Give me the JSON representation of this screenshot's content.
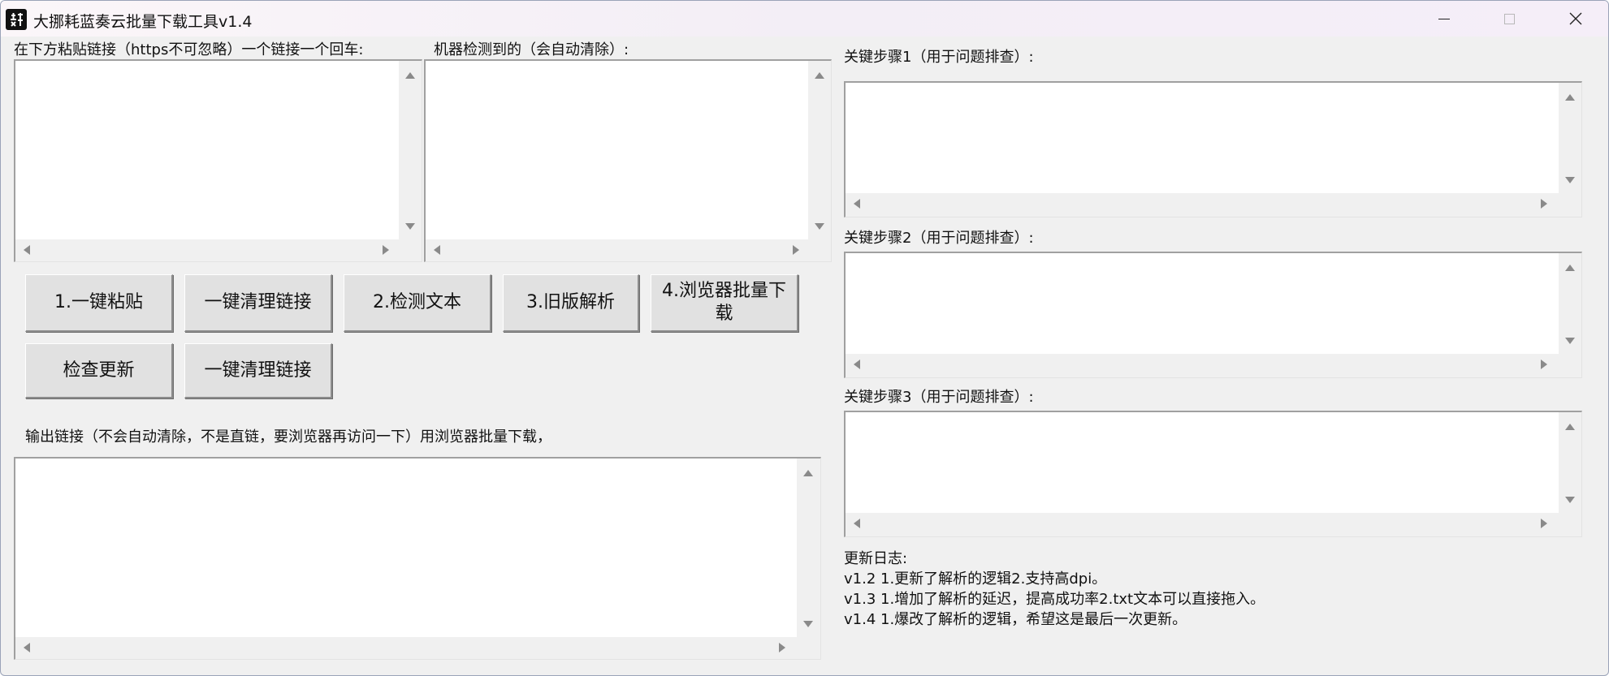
{
  "window": {
    "title": "大挪耗蓝奏云批量下载工具v1.4"
  },
  "labels": {
    "paste": "在下方粘贴链接（https不可忽略）一个链接一个回车:",
    "detected": "机器检测到的（会自动清除）:",
    "output": "输出链接（不会自动清除，不是直链，要浏览器再访问一下）用浏览器批量下载，",
    "step1": "关键步骤1（用于问题排查）:",
    "step2": "关键步骤2（用于问题排查）:",
    "step3": "关键步骤3（用于问题排查）:"
  },
  "buttons": {
    "paste": "1.一键粘贴",
    "clear1": "一键清理链接",
    "detect": "2.检测文本",
    "legacy": "3.旧版解析",
    "browser_line1": "4.浏览器批量下",
    "browser_line2": "载",
    "update": "检查更新",
    "clear2": "一键清理链接"
  },
  "changelog": {
    "header": "更新日志:",
    "lines": [
      "v1.2 1.更新了解析的逻辑2.支持高dpi。",
      "v1.3 1.增加了解析的延迟，提高成功率2.txt文本可以直接拖入。",
      "v1.4 1.爆改了解析的逻辑，希望这是最后一次更新。"
    ]
  },
  "icons": {
    "app": "app-logo-icon",
    "minimize": "minimize-icon",
    "maximize": "maximize-icon",
    "close": "close-icon"
  }
}
